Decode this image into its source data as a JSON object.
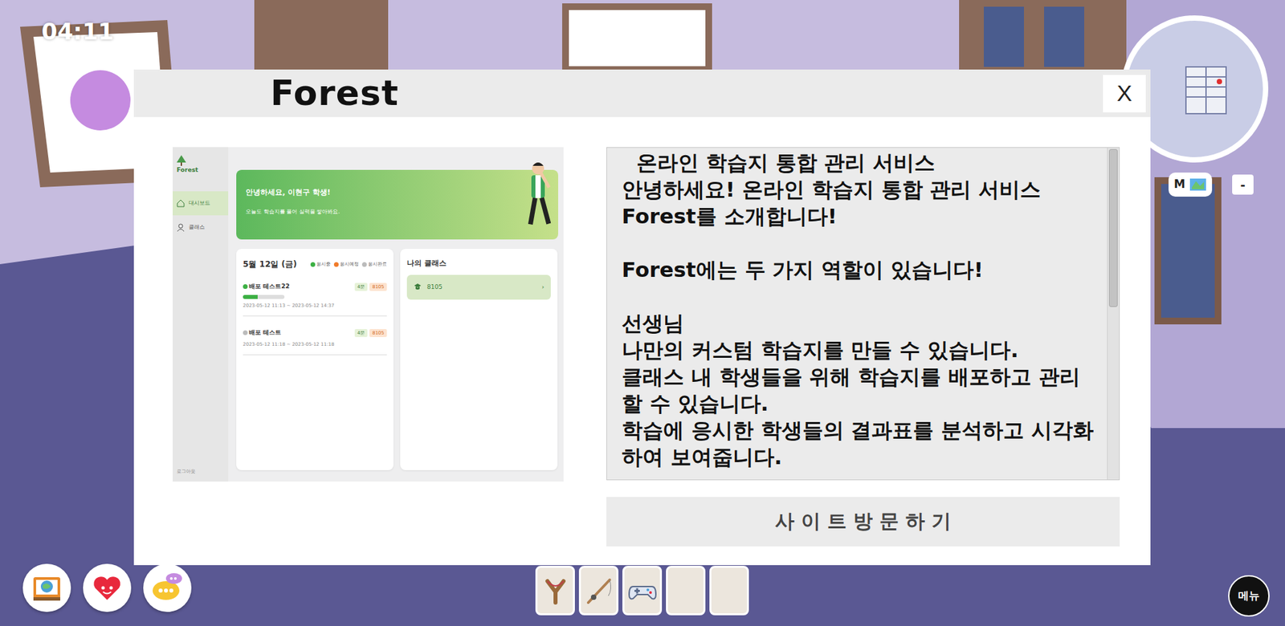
{
  "hud": {
    "clock": "04:11",
    "map_button": "M",
    "map_collapse": "-",
    "menu": "메뉴"
  },
  "modal": {
    "title": "Forest",
    "close": "X",
    "description": [
      [
        "온라인 학습지 통합 관리 서비스",
        "안녕하세요! 온라인 학습지 통합 관리 서비스 Forest를 소개합니다!"
      ],
      [
        "Forest에는 두 가지 역할이 있습니다!"
      ],
      [
        "선생님",
        "나만의 커스텀 학습지를 만들 수 있습니다.",
        "클래스 내 학생들을 위해 학습지를 배포하고 관리할 수 있습니다.",
        "학습에 응시한 학생들의 결과표를 분석하고 시각화하여 보여줍니다."
      ]
    ],
    "scroll_thumb": 0.48,
    "button": "사 이 트 방 문 하 기"
  },
  "preview": {
    "logo": "Forest",
    "nav": [
      {
        "label": "대시보드",
        "selected": true
      },
      {
        "label": "클래스",
        "selected": false
      }
    ],
    "logout": "로그아웃",
    "banner_title": "안녕하세요, 이현구 학생!",
    "banner_sub": "오늘도 학습지를 풀어 실력을 쌓아봐요.",
    "date": "5월 12일 (금)",
    "legend": [
      {
        "label": "응시중",
        "color": "#3cb043"
      },
      {
        "label": "응시예정",
        "color": "#f07b2a"
      },
      {
        "label": "응시완료",
        "color": "#bbbbbb"
      }
    ],
    "tests": [
      {
        "title": "배포 테스트22",
        "color": "#3cb043",
        "level": 0.35,
        "period": "2023-05-12 11:13 ~ 2023-05-12 14:37",
        "tags": [
          "4문",
          "8105"
        ]
      },
      {
        "title": "배포 테스트",
        "color": "#bbbbbb",
        "level": null,
        "period": "2023-05-12 11:18 ~ 2023-05-12 11:18",
        "tags": [
          "4문",
          "8105"
        ]
      }
    ],
    "class_title": "나의 클래스",
    "classes": [
      {
        "name": "8105",
        "arrow": "›"
      }
    ]
  },
  "quick_buttons": [
    {
      "kind": "guide"
    },
    {
      "kind": "emote"
    },
    {
      "kind": "chat"
    }
  ],
  "hotbar": [
    {
      "kind": "slingshot"
    },
    {
      "kind": "rod"
    },
    {
      "kind": "gamepad"
    },
    {
      "kind": "empty"
    },
    {
      "kind": "empty"
    }
  ]
}
